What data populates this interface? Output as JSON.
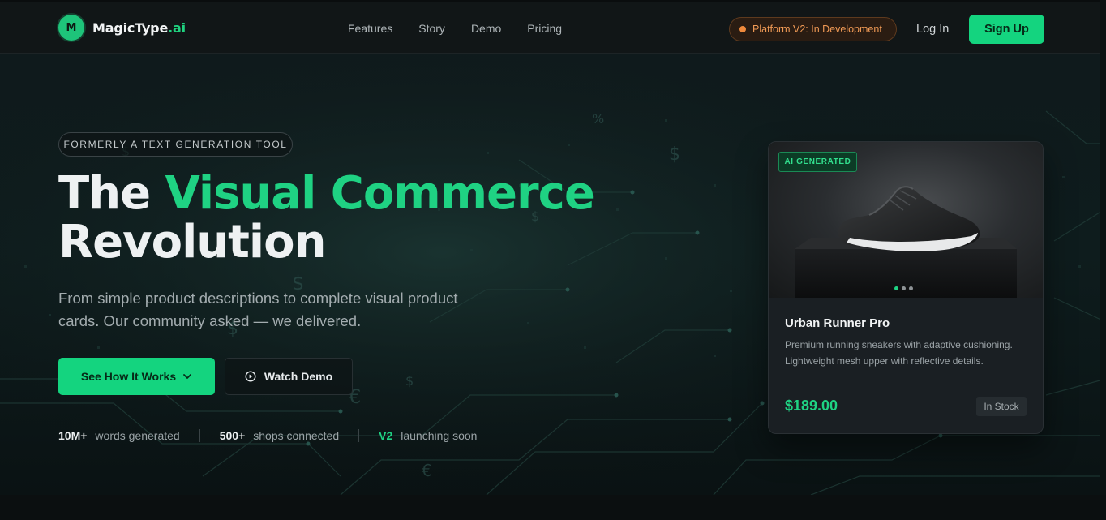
{
  "brand": {
    "mark": "M",
    "name": "MagicType",
    "suffix": ".ai"
  },
  "nav": {
    "links": [
      "Features",
      "Story",
      "Demo",
      "Pricing"
    ],
    "badge": "Platform V2: In Development",
    "login": "Log In",
    "signup": "Sign Up"
  },
  "hero": {
    "eyebrow": "FORMERLY A TEXT GENERATION TOOL",
    "headline_part1": "The ",
    "headline_accent": "Visual Commerce",
    "headline_part2": "Revolution",
    "subtitle": "From simple product descriptions to complete visual product cards. Our community asked — we delivered.",
    "primary_cta": "See How It Works",
    "secondary_cta": "Watch Demo",
    "stats": [
      {
        "value": "10M+",
        "label": "words generated"
      },
      {
        "value": "500+",
        "label": "shops connected"
      },
      {
        "value": "V2",
        "label": "launching soon"
      }
    ]
  },
  "card": {
    "badge": "AI GENERATED",
    "title": "Urban Runner Pro",
    "description": "Premium running sneakers with adaptive cushioning. Lightweight mesh upper with reflective details.",
    "price": "$189.00",
    "stock": "In Stock",
    "carousel_active": 1,
    "carousel_count": 3
  },
  "icons": {
    "primary_cta": "chevron-down-icon",
    "secondary_cta": "play-circle-icon",
    "badge": "status-dot-icon"
  },
  "colors": {
    "accent": "#14d47f",
    "accent_text": "#1fd283",
    "badge_orange": "#f09a55",
    "background": "#0d1214"
  }
}
